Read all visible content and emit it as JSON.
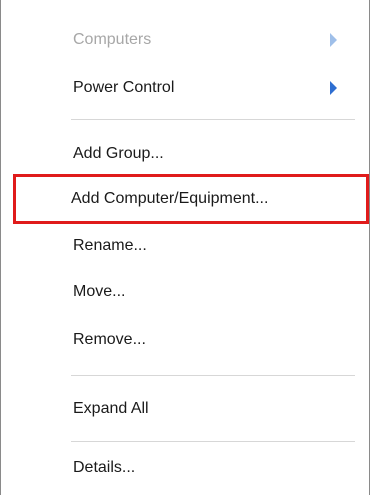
{
  "menu": {
    "items": [
      {
        "label": "Computers",
        "icon": "chevron-right-icon"
      },
      {
        "label": "Power Control",
        "icon": "chevron-right-icon"
      },
      {
        "label": "Add Group..."
      },
      {
        "label": "Add Computer/Equipment..."
      },
      {
        "label": "Rename..."
      },
      {
        "label": "Move..."
      },
      {
        "label": "Remove..."
      },
      {
        "label": "Expand All"
      },
      {
        "label": "Details..."
      }
    ]
  },
  "colors": {
    "highlight_border": "#e01b1b",
    "submenu_arrow": "#2e6ed1",
    "disabled_text": "#a7a7a7"
  }
}
